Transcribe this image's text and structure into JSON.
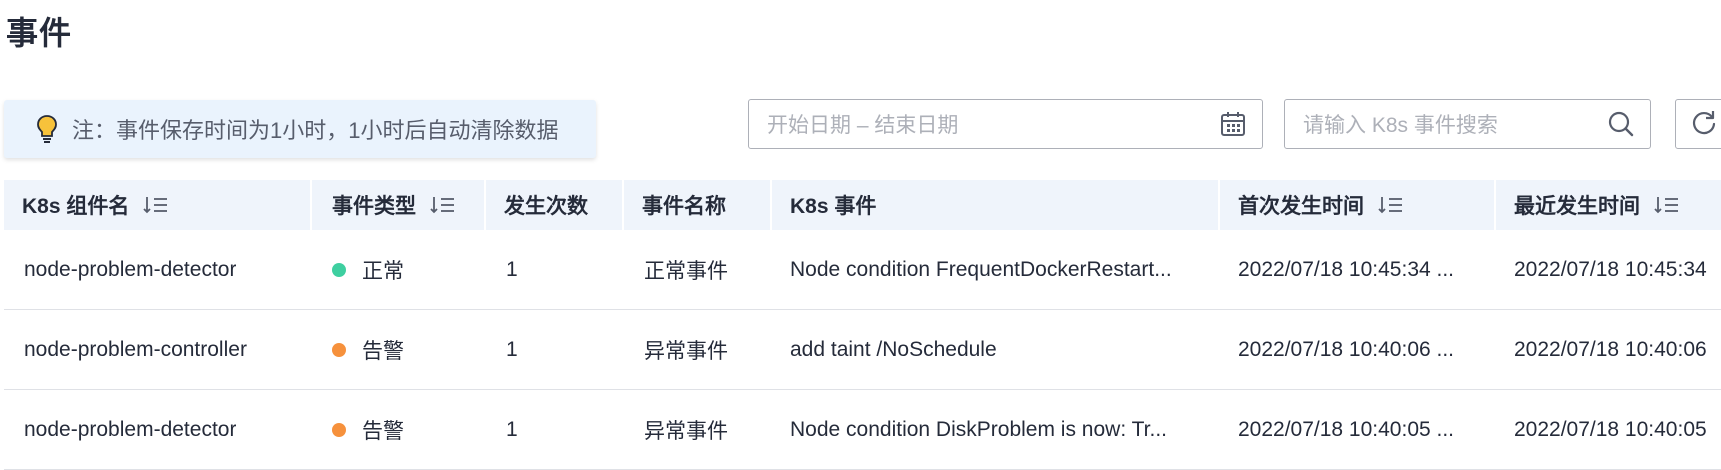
{
  "page": {
    "title": "事件"
  },
  "notice": {
    "text": "注：事件保存时间为1小时，1小时后自动清除数据",
    "icon": "lightbulb-icon"
  },
  "filters": {
    "date_range_placeholder": "开始日期 – 结束日期",
    "search_placeholder": "请输入 K8s 事件搜索"
  },
  "table": {
    "headers": {
      "component": "K8s 组件名",
      "type": "事件类型",
      "count": "发生次数",
      "name": "事件名称",
      "event": "K8s 事件",
      "first_time": "首次发生时间",
      "last_time": "最近发生时间"
    },
    "rows": [
      {
        "component": "node-problem-detector",
        "type": "正常",
        "type_color": "#3ecfa0",
        "count": "1",
        "name": "正常事件",
        "event": "Node condition FrequentDockerRestart...",
        "first_time": "2022/07/18 10:45:34 ...",
        "last_time": "2022/07/18 10:45:34"
      },
      {
        "component": "node-problem-controller",
        "type": "告警",
        "type_color": "#f6913c",
        "count": "1",
        "name": "异常事件",
        "event": "add taint /NoSchedule",
        "first_time": "2022/07/18 10:40:06 ...",
        "last_time": "2022/07/18 10:40:06"
      },
      {
        "component": "node-problem-detector",
        "type": "告警",
        "type_color": "#f6913c",
        "count": "1",
        "name": "异常事件",
        "event": "Node condition DiskProblem is now: Tr...",
        "first_time": "2022/07/18 10:40:05 ...",
        "last_time": "2022/07/18 10:40:05"
      }
    ]
  },
  "colors": {
    "header_bg": "#eff4fb",
    "notice_bg": "#eaf3fd",
    "normal": "#3ecfa0",
    "warning": "#f6913c"
  }
}
